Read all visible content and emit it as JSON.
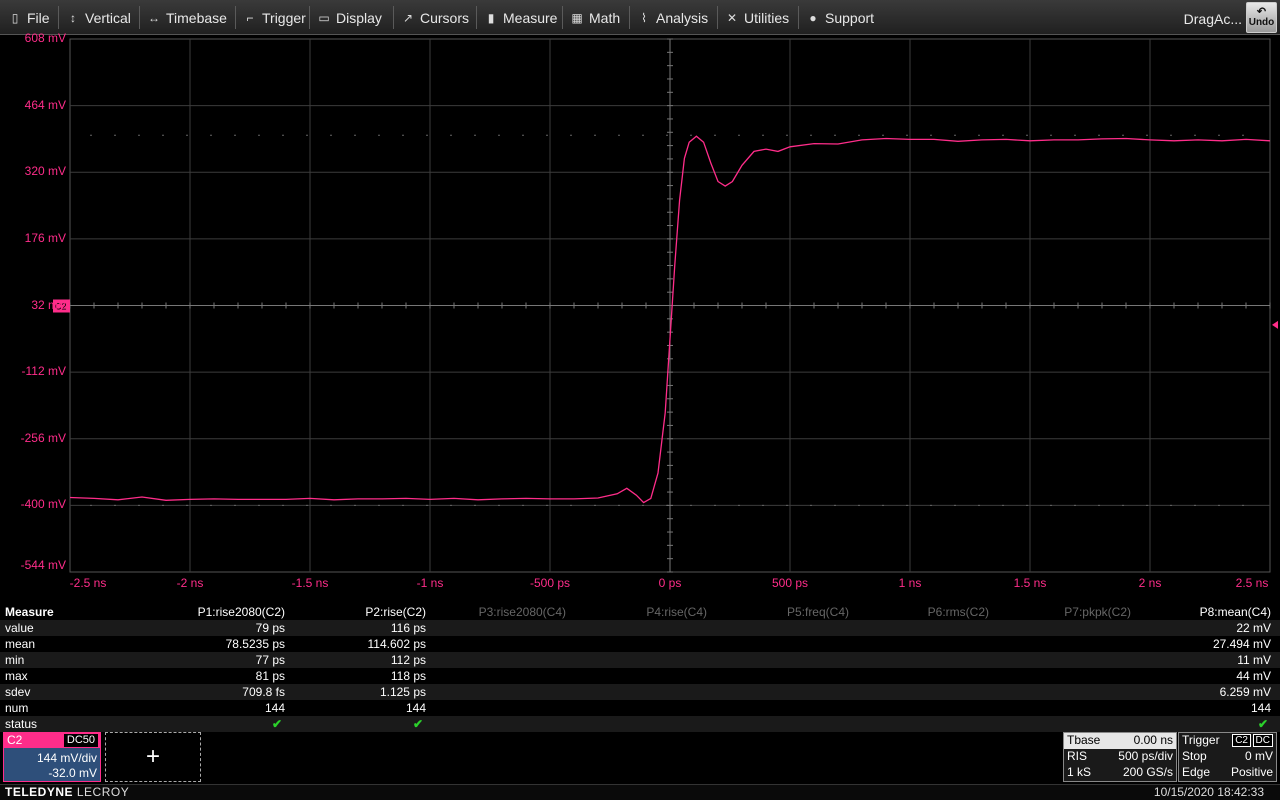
{
  "menu": [
    {
      "label": "File",
      "icon": "file-icon",
      "glyph": "▯",
      "x": 8
    },
    {
      "label": "Vertical",
      "icon": "vertical-icon",
      "glyph": "↕",
      "x": 66
    },
    {
      "label": "Timebase",
      "icon": "timebase-icon",
      "glyph": "↔",
      "x": 147
    },
    {
      "label": "Trigger",
      "icon": "trigger-icon",
      "glyph": "⌐",
      "x": 243
    },
    {
      "label": "Display",
      "icon": "display-icon",
      "glyph": "▭",
      "x": 317
    },
    {
      "label": "Cursors",
      "icon": "cursors-icon",
      "glyph": "↗",
      "x": 401
    },
    {
      "label": "Measure",
      "icon": "measure-icon",
      "glyph": "▮",
      "x": 484
    },
    {
      "label": "Math",
      "icon": "math-icon",
      "glyph": "▦",
      "x": 570
    },
    {
      "label": "Analysis",
      "icon": "analysis-icon",
      "glyph": "⌇",
      "x": 637
    },
    {
      "label": "Utilities",
      "icon": "utilities-icon",
      "glyph": "✕",
      "x": 725
    },
    {
      "label": "Support",
      "icon": "support-icon",
      "glyph": "●",
      "x": 806
    }
  ],
  "drag_action": "DragAc...",
  "undo_label": "Undo",
  "colors": {
    "trace": "#ff2d8a",
    "grid": "#3c3c3c",
    "check": "#2bd12b"
  },
  "chart_data": {
    "type": "line",
    "series": [
      {
        "name": "C2"
      }
    ],
    "y_tick_labels": [
      "608 mV",
      "464 mV",
      "320 mV",
      "176 mV",
      "32 mV",
      "-112 mV",
      "-256 mV",
      "-400 mV",
      "-544 mV"
    ],
    "x_tick_labels": [
      "-2.5 ns",
      "-2 ns",
      "-1.5 ns",
      "-1 ns",
      "-500 ps",
      "0 ps",
      "500 ps",
      "1 ns",
      "1.5 ns",
      "2 ns",
      "2.5 ns"
    ],
    "ylim_mV": [
      -544,
      608
    ],
    "xlim_ps": [
      -2500,
      2500
    ],
    "trace_label": "C2",
    "points": [
      [
        -2500,
        -383
      ],
      [
        -2400,
        -385
      ],
      [
        -2300,
        -388
      ],
      [
        -2200,
        -382
      ],
      [
        -2100,
        -389
      ],
      [
        -2000,
        -387
      ],
      [
        -1900,
        -386
      ],
      [
        -1800,
        -387
      ],
      [
        -1700,
        -387
      ],
      [
        -1600,
        -387
      ],
      [
        -1500,
        -385
      ],
      [
        -1400,
        -388
      ],
      [
        -1300,
        -386
      ],
      [
        -1200,
        -386
      ],
      [
        -1100,
        -385
      ],
      [
        -1000,
        -387
      ],
      [
        -900,
        -385
      ],
      [
        -800,
        -388
      ],
      [
        -700,
        -386
      ],
      [
        -600,
        -385
      ],
      [
        -500,
        -386
      ],
      [
        -400,
        -386
      ],
      [
        -300,
        -384
      ],
      [
        -220,
        -375
      ],
      [
        -180,
        -363
      ],
      [
        -140,
        -378
      ],
      [
        -110,
        -394
      ],
      [
        -80,
        -385
      ],
      [
        -50,
        -330
      ],
      [
        -20,
        -200
      ],
      [
        0,
        -40
      ],
      [
        20,
        120
      ],
      [
        40,
        260
      ],
      [
        60,
        350
      ],
      [
        80,
        385
      ],
      [
        110,
        398
      ],
      [
        140,
        385
      ],
      [
        170,
        340
      ],
      [
        200,
        300
      ],
      [
        230,
        290
      ],
      [
        260,
        300
      ],
      [
        300,
        335
      ],
      [
        350,
        365
      ],
      [
        400,
        370
      ],
      [
        450,
        365
      ],
      [
        500,
        375
      ],
      [
        600,
        382
      ],
      [
        700,
        381
      ],
      [
        800,
        390
      ],
      [
        900,
        393
      ],
      [
        1000,
        391
      ],
      [
        1100,
        391
      ],
      [
        1200,
        387
      ],
      [
        1300,
        390
      ],
      [
        1400,
        391
      ],
      [
        1500,
        388
      ],
      [
        1600,
        390
      ],
      [
        1700,
        390
      ],
      [
        1800,
        392
      ],
      [
        1900,
        393
      ],
      [
        2000,
        390
      ],
      [
        2100,
        388
      ],
      [
        2200,
        390
      ],
      [
        2300,
        388
      ],
      [
        2400,
        391
      ],
      [
        2500,
        388
      ]
    ]
  },
  "measure": {
    "title": "Measure",
    "headers": [
      {
        "label": "P1:rise2080(C2)",
        "active": true
      },
      {
        "label": "P2:rise(C2)",
        "active": true
      },
      {
        "label": "P3:rise2080(C4)",
        "active": false
      },
      {
        "label": "P4:rise(C4)",
        "active": false
      },
      {
        "label": "P5:freq(C4)",
        "active": false
      },
      {
        "label": "P6:rms(C2)",
        "active": false
      },
      {
        "label": "P7:pkpk(C2)",
        "active": false
      },
      {
        "label": "P8:mean(C4)",
        "active": true
      }
    ],
    "rows": [
      {
        "label": "value",
        "p1": "79 ps",
        "p2": "116 ps",
        "p8": "22 mV"
      },
      {
        "label": "mean",
        "p1": "78.5235 ps",
        "p2": "114.602 ps",
        "p8": "27.494 mV"
      },
      {
        "label": "min",
        "p1": "77 ps",
        "p2": "112 ps",
        "p8": "11 mV"
      },
      {
        "label": "max",
        "p1": "81 ps",
        "p2": "118 ps",
        "p8": "44 mV"
      },
      {
        "label": "sdev",
        "p1": "709.8 fs",
        "p2": "1.125 ps",
        "p8": "6.259 mV"
      },
      {
        "label": "num",
        "p1": "144",
        "p2": "144",
        "p8": "144"
      },
      {
        "label": "status",
        "p1": "✔",
        "p2": "✔",
        "p8": "✔"
      }
    ]
  },
  "channel": {
    "name": "C2",
    "coupling": "DC50",
    "vdiv": "144 mV/div",
    "offset": "-32.0 mV"
  },
  "add_label": "+",
  "timebase": {
    "title": "Tbase",
    "delay": "0.00 ns",
    "mode": "RIS",
    "tdiv": "500 ps/div",
    "points": "1 kS",
    "rate": "200 GS/s"
  },
  "trigger": {
    "title": "Trigger",
    "src": "C2",
    "coupling": "DC",
    "mode": "Stop",
    "level": "0 mV",
    "type": "Edge",
    "slope": "Positive"
  },
  "footer": {
    "brand_bold": "TELEDYNE",
    "brand_rest": " LECROY",
    "datetime": "10/15/2020 18:42:33"
  }
}
